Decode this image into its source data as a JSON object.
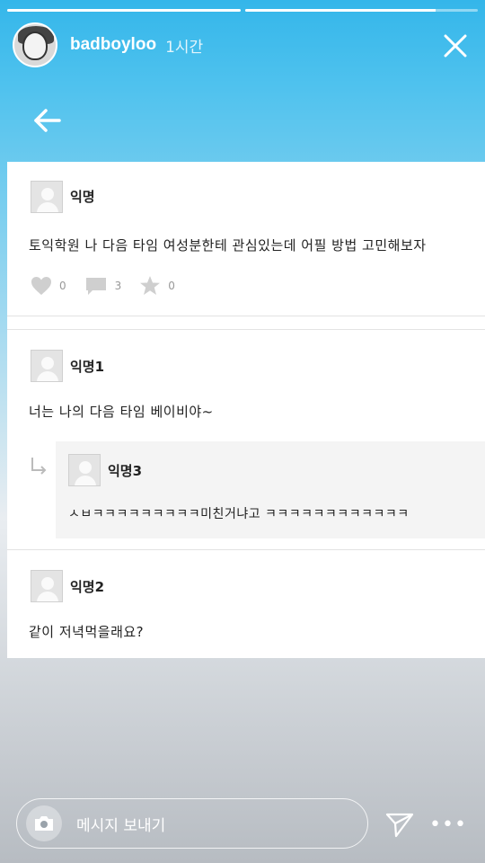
{
  "story": {
    "progress": [
      1.0,
      0.82
    ],
    "username": "badboyloo",
    "time_ago": "1시간",
    "message_placeholder": "메시지 보내기"
  },
  "posts": [
    {
      "author": "익명",
      "content": "토익학원 나 다음 타임 여성분한테 관심있는데 어필 방법 고민해보자",
      "likes": "0",
      "comments": "3",
      "scraps": "0"
    },
    {
      "author": "익명1",
      "content": "너는 나의 다음 타임 베이비야~",
      "reply": {
        "author": "익명3",
        "content": "ㅅㅂㅋㅋㅋㅋㅋㅋㅋㅋㅋ미친거냐고 ㅋㅋㅋㅋㅋㅋㅋㅋㅋㅋㅋㅋ"
      }
    },
    {
      "author": "익명2",
      "content": "같이 저녁먹을래요?"
    }
  ],
  "colors": {
    "accent": "#34b6ea",
    "panel": "#ffffff"
  }
}
